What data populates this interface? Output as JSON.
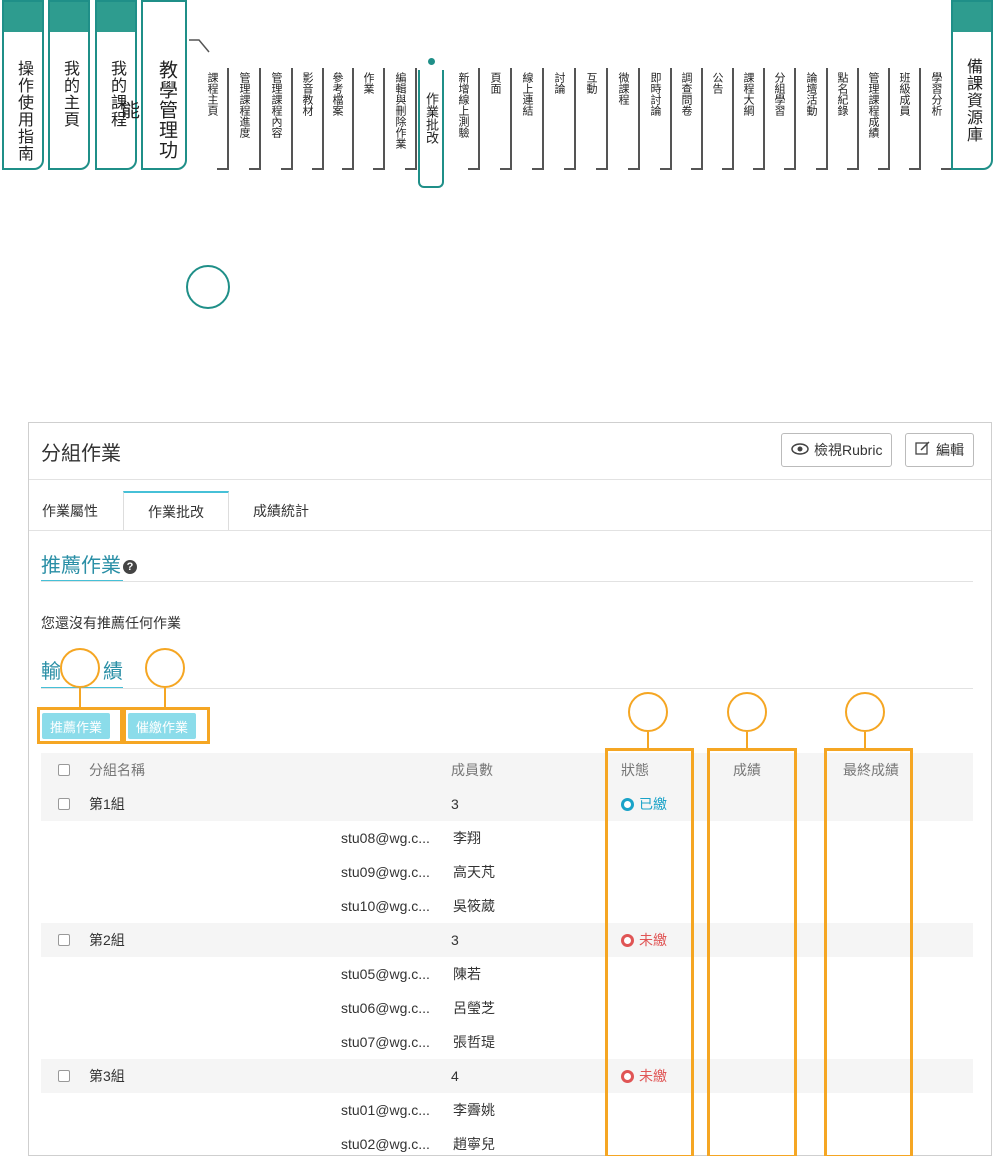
{
  "nav": {
    "main_tabs": [
      {
        "label": "操作使用指南"
      },
      {
        "label": "我的主頁"
      },
      {
        "label": "我的課程"
      },
      {
        "label": "教學管理功能"
      }
    ],
    "sub_items": [
      "課程主頁",
      "管理課程進度",
      "管理課程內容",
      "影音教材",
      "參考檔案",
      "作業",
      "編輯與刪除作業",
      "新增線上測驗",
      "頁面",
      "線上連結",
      "討論",
      "互動",
      "微課程",
      "即時討論",
      "調查問卷",
      "公告",
      "課程大綱",
      "分組學習",
      "論壇活動",
      "點名紀錄",
      "管理課程成績",
      "班級成員",
      "學習分析"
    ],
    "active_item": "作業批改",
    "right_tab": "備課資源庫"
  },
  "panel": {
    "title": "分組作業",
    "rubric_label": "檢視Rubric",
    "edit_label": "編輯",
    "tabs": [
      "作業屬性",
      "作業批改",
      "成績統計"
    ],
    "recommended_title": "推薦作業",
    "empty_message": "您還沒有推薦任何作業",
    "grades_title_left": "輸",
    "grades_title_right": "績",
    "btn_recommend": "推薦作業",
    "btn_remind": "催繳作業",
    "columns": {
      "group_name": "分組名稱",
      "members": "成員數",
      "status": "狀態",
      "grade": "成績",
      "final": "最終成績"
    },
    "groups": [
      {
        "name": "第1組",
        "count": "3",
        "status": "已繳",
        "status_color": "#1aa3c8",
        "members": [
          {
            "email": "stu08@wg.c...",
            "name": "李翔"
          },
          {
            "email": "stu09@wg.c...",
            "name": "高天芃"
          },
          {
            "email": "stu10@wg.c...",
            "name": "吳筱葳"
          }
        ]
      },
      {
        "name": "第2組",
        "count": "3",
        "status": "未繳",
        "status_color": "#e05555",
        "members": [
          {
            "email": "stu05@wg.c...",
            "name": "陳若"
          },
          {
            "email": "stu06@wg.c...",
            "name": "呂瑩芝"
          },
          {
            "email": "stu07@wg.c...",
            "name": "張哲瑅"
          }
        ]
      },
      {
        "name": "第3組",
        "count": "4",
        "status": "未繳",
        "status_color": "#e05555",
        "members": [
          {
            "email": "stu01@wg.c...",
            "name": "李霽姚"
          },
          {
            "email": "stu02@wg.c...",
            "name": "趙寧兒"
          }
        ]
      }
    ]
  },
  "colors": {
    "teal": "#1f8f88",
    "cyan": "#46c0d7",
    "orange": "#f5a623"
  }
}
